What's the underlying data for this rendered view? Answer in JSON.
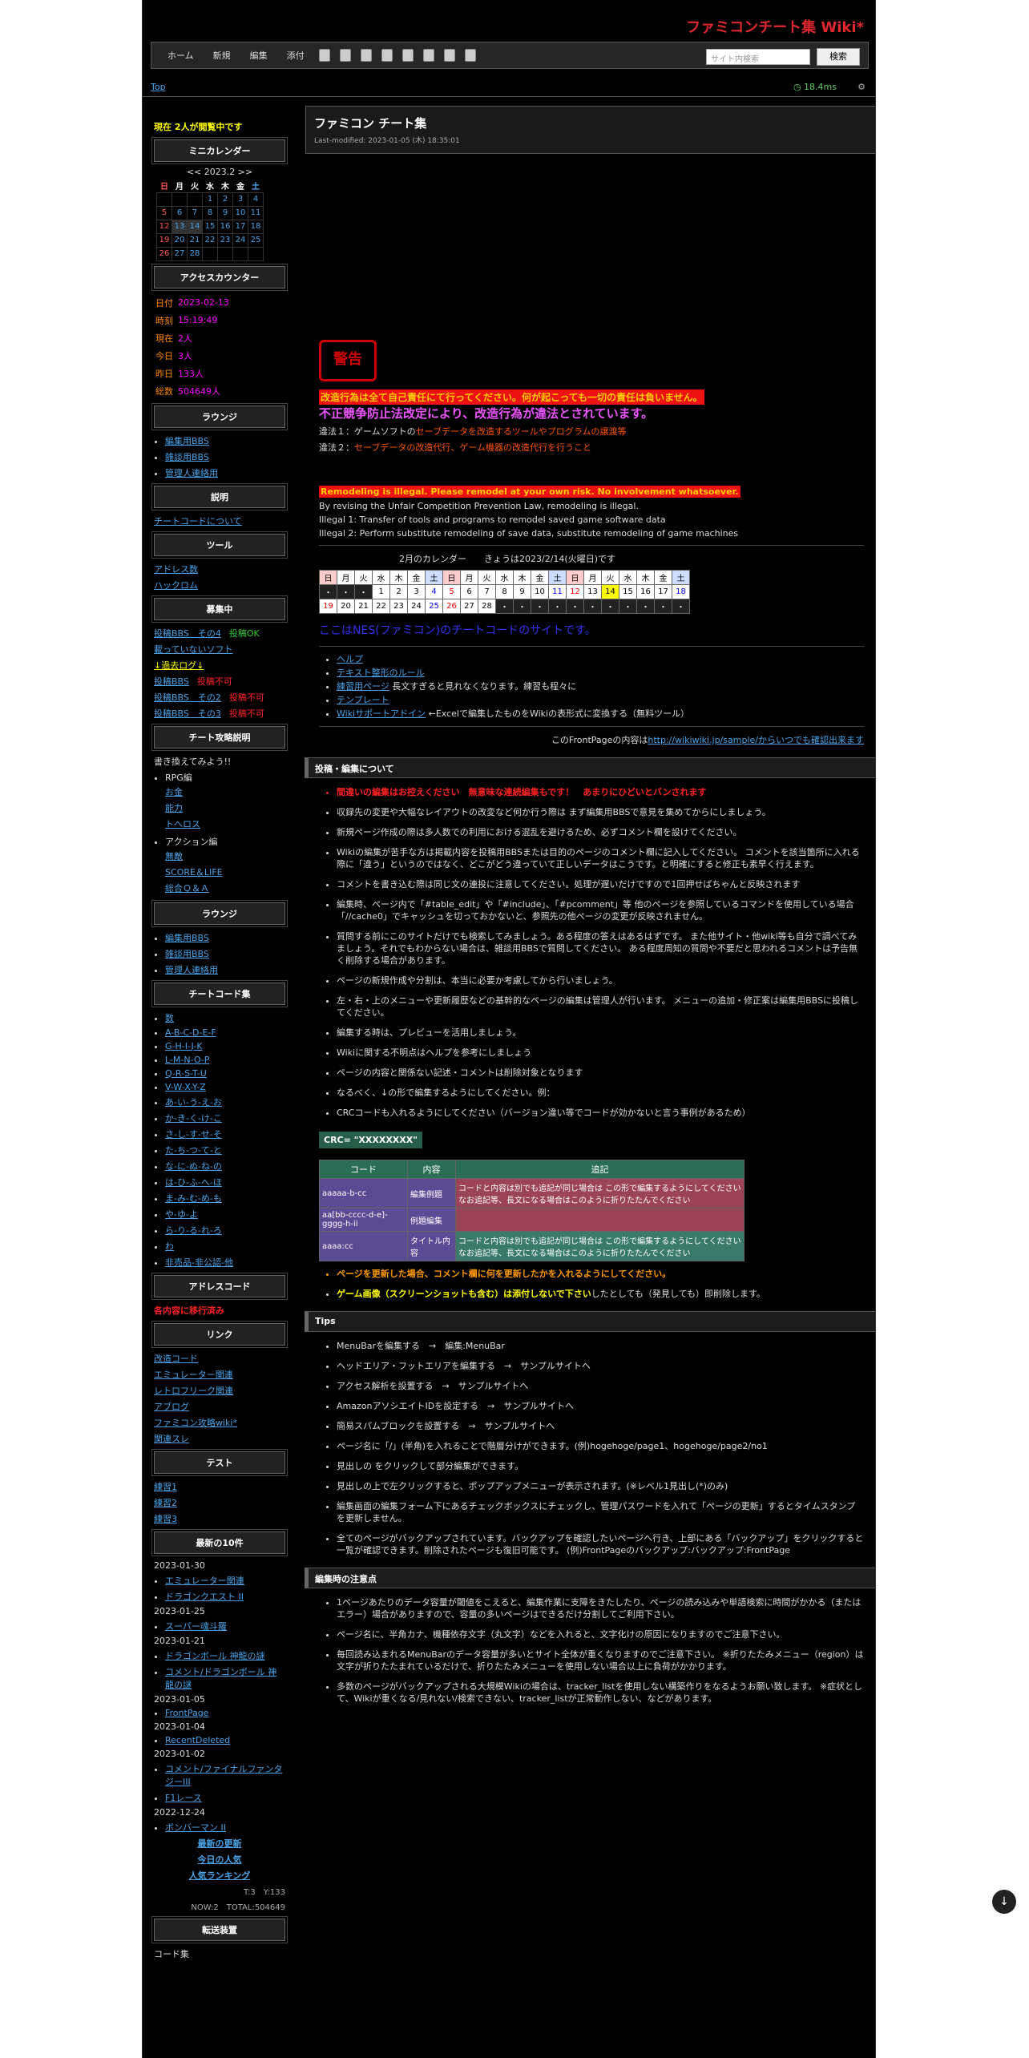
{
  "site_title": "ファミコンチート集 Wiki*",
  "nav": {
    "items": [
      "ホーム",
      "新規",
      "編集",
      "添付"
    ],
    "search_placeholder": "サイト内検索",
    "search_button": "検索"
  },
  "topbar": {
    "link": "Top",
    "time": "18.4ms"
  },
  "sidebar": {
    "viewers": "現在 2人が閲覧中です",
    "minical_title": "ミニカレンダー",
    "minical_nav": "<< 2023.2 >>",
    "minical_days": [
      "日",
      "月",
      "火",
      "水",
      "木",
      "金",
      "土"
    ],
    "minical_rows": [
      [
        "",
        "",
        "",
        "1",
        "2",
        "3",
        "4"
      ],
      [
        "5",
        "6",
        "7",
        "8",
        "9",
        "10",
        "11"
      ],
      [
        "12",
        "13",
        "14",
        "15",
        "16",
        "17",
        "18"
      ],
      [
        "19",
        "20",
        "21",
        "22",
        "23",
        "24",
        "25"
      ],
      [
        "26",
        "27",
        "28",
        "",
        "",
        "",
        ""
      ]
    ],
    "access_title": "アクセスカウンター",
    "access": [
      {
        "k": "日付",
        "v": "2023-02-13"
      },
      {
        "k": "時刻",
        "v": "15:19:49"
      },
      {
        "k": "現在",
        "v": "2人"
      },
      {
        "k": "今日",
        "v": "3人"
      },
      {
        "k": "昨日",
        "v": "133人"
      },
      {
        "k": "総数",
        "v": "504649人"
      }
    ],
    "lounge_title": "ラウンジ",
    "lounge": [
      "編集用BBS",
      "雑談用BBS",
      "管理人連絡用"
    ],
    "explain_title": "説明",
    "explain": "チートコードについて",
    "tool_title": "ツール",
    "tools": [
      "アドレス数",
      "ハックロム"
    ],
    "recruit_title": "募集中",
    "recruit": [
      {
        "a": "投稿BBS　その4",
        "b": "投稿OK"
      },
      {
        "a": "載っていないソフト",
        "b": ""
      },
      {
        "a": "↓過去ログ↓",
        "b": ""
      },
      {
        "a": "投稿BBS",
        "b": "投稿不可"
      },
      {
        "a": "投稿BBS　その2",
        "b": "投稿不可"
      },
      {
        "a": "投稿BBS　その3",
        "b": "投稿不可"
      }
    ],
    "strategy_title": "チート攻略説明",
    "strategy_note": "書き換えてみよう!!",
    "strategy_rpg": "RPG編",
    "strategy_rpg_items": [
      "お金",
      "能力",
      "トへロス"
    ],
    "strategy_action": "アクション編",
    "strategy_action_items": [
      "無敵",
      "SCORE＆LIFE",
      "総合Ｑ＆Ａ"
    ],
    "lounge2_title": "ラウンジ",
    "codes_title": "チートコード集",
    "codes": [
      "数",
      "A-B-C-D-E-F",
      "G-H-I-J-K",
      "L-M-N-O-P",
      "Q-R-S-T-U",
      "V-W-X-Y-Z",
      "あ-い-う-え-お",
      "か-き-く-け-こ",
      "さ-し-す-せ-そ",
      "た-ち-つ-て-と",
      "な-に-ぬ-ね-の",
      "は-ひ-ふ-へ-ほ",
      "ま-み-む-め-も",
      "や-ゆ-よ",
      "ら-り-る-れ-ろ",
      "わ",
      "非売品-非公認-他"
    ],
    "address_title": "アドレスコード",
    "address_note": "各内容に移行済み",
    "links_title": "リンク",
    "links": [
      "改造コード",
      "エミュレーター関連",
      "レトロフリーク関連",
      "アブログ",
      "ファミコン攻略wiki*",
      "関連スレ"
    ],
    "test_title": "テスト",
    "tests": [
      "練習1",
      "練習2",
      "練習3"
    ],
    "recent_title": "最新の10件",
    "recent": [
      {
        "date": "2023-01-30",
        "items": [
          "エミュレーター関連",
          "ドラゴンクエスト II"
        ]
      },
      {
        "date": "2023-01-25",
        "items": [
          "スーパー魂斗羅"
        ]
      },
      {
        "date": "2023-01-21",
        "items": [
          "ドラゴンボール 神龍の謎",
          "コメント/ドラゴンボール 神龍の謎"
        ]
      },
      {
        "date": "2023-01-05",
        "items": [
          "FrontPage"
        ]
      },
      {
        "date": "2023-01-04",
        "items": [
          "RecentDeleted"
        ]
      },
      {
        "date": "2023-01-02",
        "items": [
          "コメント/ファイナルファンタジーIII",
          "F1レース"
        ]
      },
      {
        "date": "2022-12-24",
        "items": [
          "ボンバーマン II"
        ]
      }
    ],
    "latest": [
      "最新の更新",
      "今日の人気",
      "人気ランキング"
    ],
    "counter": "T:3　Y:133",
    "counter2": "NOW:2　TOTAL:504649",
    "transfer_title": "転送装置",
    "transfer_label": "コード集"
  },
  "main": {
    "title": "ファミコン チート集",
    "modified": "Last-modified: 2023-01-05 (木) 18:35:01",
    "warn_icon": "警告",
    "warn1": "改造行為は全て自己責任にて行ってください。何が起こっても一切の責任は負いません。",
    "warn2": "不正競争防止法改定により、改造行為が違法とされています。",
    "illegal1a": "違法１：ゲームソフトの",
    "illegal1b": "セーブデータを改造するツールやプログラムの譲渡等",
    "illegal2a": "違法２：",
    "illegal2b": "セーブデータの改造代行、ゲーム機器の改造代行を行うこと",
    "en_warn": "Remodeling is illegal. Please remodel at your own risk. No involvement whatsoever.",
    "en1": "By revising the Unfair Competition Prevention Law, remodeling is illegal.",
    "en2": "Illegal 1: Transfer of tools and programs to remodel saved game software data",
    "en3": "Illegal 2: Perform substitute remodeling of save data, substitute remodeling of game machines",
    "cal_label": "2月のカレンダー　　きょうは2023/2/14(火曜日)です",
    "cal_head": [
      "日",
      "月",
      "火",
      "水",
      "木",
      "金",
      "土",
      "日",
      "月",
      "火",
      "水",
      "木",
      "金",
      "土",
      "日",
      "月",
      "火",
      "水",
      "木",
      "金",
      "土"
    ],
    "cal_row1": [
      "・",
      "・",
      "・",
      "1",
      "2",
      "3",
      "4",
      "5",
      "6",
      "7",
      "8",
      "9",
      "10",
      "11",
      "12",
      "13",
      "14",
      "15",
      "16",
      "17",
      "18"
    ],
    "cal_row2": [
      "19",
      "20",
      "21",
      "22",
      "23",
      "24",
      "25",
      "26",
      "27",
      "28",
      "・",
      "・",
      "・",
      "・",
      "・",
      "・",
      "・",
      "・",
      "・",
      "・",
      "・"
    ],
    "site_note": "ここはNES(ファミコン)のチートコードのサイトです。",
    "help_links": [
      "ヘルプ",
      "テキスト整形のルール",
      "練習用ページ",
      "テンプレート",
      "Wikiサポートアドイン"
    ],
    "help_note1": "長文すぎると見れなくなります。練習も程々に",
    "help_note2": "←Excelで編集したものをWikiの表形式に変換する（無料ツール）",
    "front_note": "このFrontPageの内容は",
    "front_link": "http://wikiwiki.jp/sample/からいつでも確認出来ます",
    "sec1": "投稿・編集について",
    "rules": [
      "間違いの編集はお控えください　無意味な連続編集もです！　あまりにひどいとバンされます",
      "収録先の変更や大幅なレイアウトの改変など何か行う際は まず編集用BBSで意見を集めてからにしましょう。",
      "新規ページ作成の際は多人数での利用における混乱を避けるため、必ずコメント欄を設けてください。",
      "Wikiの編集が苦手な方は掲載内容を投稿用BBSまたは目的のページのコメント欄に記入してください。 コメントを該当箇所に入れる際に「違う」というのではなく、どこがどう違っていて正しいデータはこうです。と明確にすると修正も素早く行えます。",
      "コメントを書き込む際は同じ文の連投に注意してください。処理が遅いだけですので1回押せばちゃんと反映されます",
      "編集時、ページ内で「#table_edit」や「#include」、「#pcomment」等 他のページを参照しているコマンドを使用している場合 「//cache0」でキャッシュを切っておかないと、参照先の他ページの変更が反映されません。",
      "質問する前にこのサイトだけでも検索してみましょう。ある程度の答えはあるはずです。 また他サイト・他wiki等も自分で調べてみましょう。それでもわからない場合は、雑談用BBSで質問してください。 ある程度周知の質問や不要だと思われるコメントは予告無く削除する場合があります。",
      "ページの新規作成や分割は、本当に必要か考慮してから行いましょう。",
      "左・右・上のメニューや更新履歴などの基幹的なページの編集は管理人が行います。 メニューの追加・修正案は編集用BBSに投稿してください。",
      "編集する時は、プレビューを活用しましょう。",
      "Wikiに関する不明点はヘルプを参考にしましょう",
      "ページの内容と関係ない記述・コメントは削除対象となります",
      "なるべく、↓の形で編集するようにしてください。例：",
      "CRCコードも入れるようにしてください（バージョン違い等でコードが効かないと言う事例があるため）"
    ],
    "crc": "CRC= \"XXXXXXXX\"",
    "table_head": [
      "コード",
      "内容",
      "追記"
    ],
    "table_rows": [
      {
        "c": "aaaaa-b-cc",
        "n": "編集例題",
        "note": "コードと内容は別でも追記が同じ場合は この形で編集するようにしてください なお追記等、長文になる場合はこのように折りたたんでください"
      },
      {
        "c": "aa[bb-cccc-d-e]-gggg-h-ii",
        "n": "例題編集",
        "note": ""
      },
      {
        "c": "aaaa:cc",
        "n": "タイトル内容",
        "note": "コードと内容は別でも追記が同じ場合は この形で編集するようにしてください なお追記等、長文になる場合はこのように折りたたんでください"
      }
    ],
    "after1": "ページを更新した場合、コメント欄に何を更新したかを入れるようにしてください。",
    "after2a": "ゲーム画像（スクリーンショットも含む）は添付しないで下さい",
    "after2b": "したとしても（発見しても）即削除します。",
    "sec2": "Tips",
    "tips": [
      "MenuBarを編集する　→　編集:MenuBar",
      "ヘッドエリア・フットエリアを編集する　→　サンプルサイトへ",
      "アクセス解析を設置する　→　サンプルサイトへ",
      "AmazonアソシエイトIDを設定する　→　サンプルサイトへ",
      "簡易スパムブロックを設置する　→　サンプルサイトへ",
      "ページ名に「/」(半角)を入れることで階層分けができます。(例)hogehoge/page1、hogehoge/page2/no1",
      "見出しの をクリックして部分編集ができます。",
      "見出しの上で左クリックすると、ポップアップメニューが表示されます。(※レベル1見出し(*)のみ)",
      "編集画面の編集フォーム下にあるチェックボックスにチェックし、管理パスワードを入れて「ページの更新」するとタイムスタンプを更新しません。",
      "全てのページがバックアップされています。バックアップを確認したいページへ行き、上部にある「バックアップ」をクリックすると一覧が確認できます。削除されたページも復旧可能です。 (例)FrontPageのバックアップ:バックアップ:FrontPage"
    ],
    "sec3": "編集時の注意点",
    "notes": [
      "1ページあたりのデータ容量が閾値をこえると、編集作業に支障をきたしたり、ページの読み込みや単語検索に時間がかかる（またはエラー）場合がありますので、容量の多いページはできるだけ分割してご利用下さい。",
      "ページ名に、半角カナ、機種依存文字（丸文字）などを入れると、文字化けの原因になりますのでご注意下さい。",
      "毎回読み込まれるMenuBarのデータ容量が多いとサイト全体が重くなりますのでご注意下さい。 ※折りたたみメニュー（region）は文字が折りたたまれているだけで、折りたたみメニューを使用しない場合以上に負荷がかかります。",
      "多数のページがバックアップされる大規模Wikiの場合は、tracker_listを使用しない構築作りをなるようお願い致します。 ※症状として、Wikiが重くなる/見れない/検索できない、tracker_listが正常動作しない、などがあります。"
    ]
  }
}
